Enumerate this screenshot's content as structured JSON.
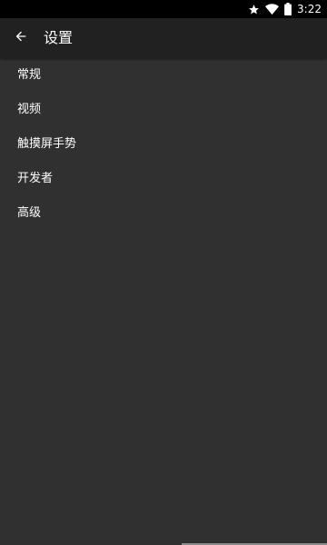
{
  "status_bar": {
    "time": "3:22",
    "icons": [
      "star-icon",
      "wifi-icon",
      "battery-icon"
    ]
  },
  "toolbar": {
    "back_icon": "arrow-back-icon",
    "title": "设置"
  },
  "settings": {
    "items": [
      {
        "label": "常规"
      },
      {
        "label": "视频"
      },
      {
        "label": "触摸屏手势"
      },
      {
        "label": "开发者"
      },
      {
        "label": "高级"
      }
    ]
  },
  "colors": {
    "background": "#303030",
    "toolbar": "#212121",
    "status_bar": "#000000",
    "text": "#ffffff"
  }
}
